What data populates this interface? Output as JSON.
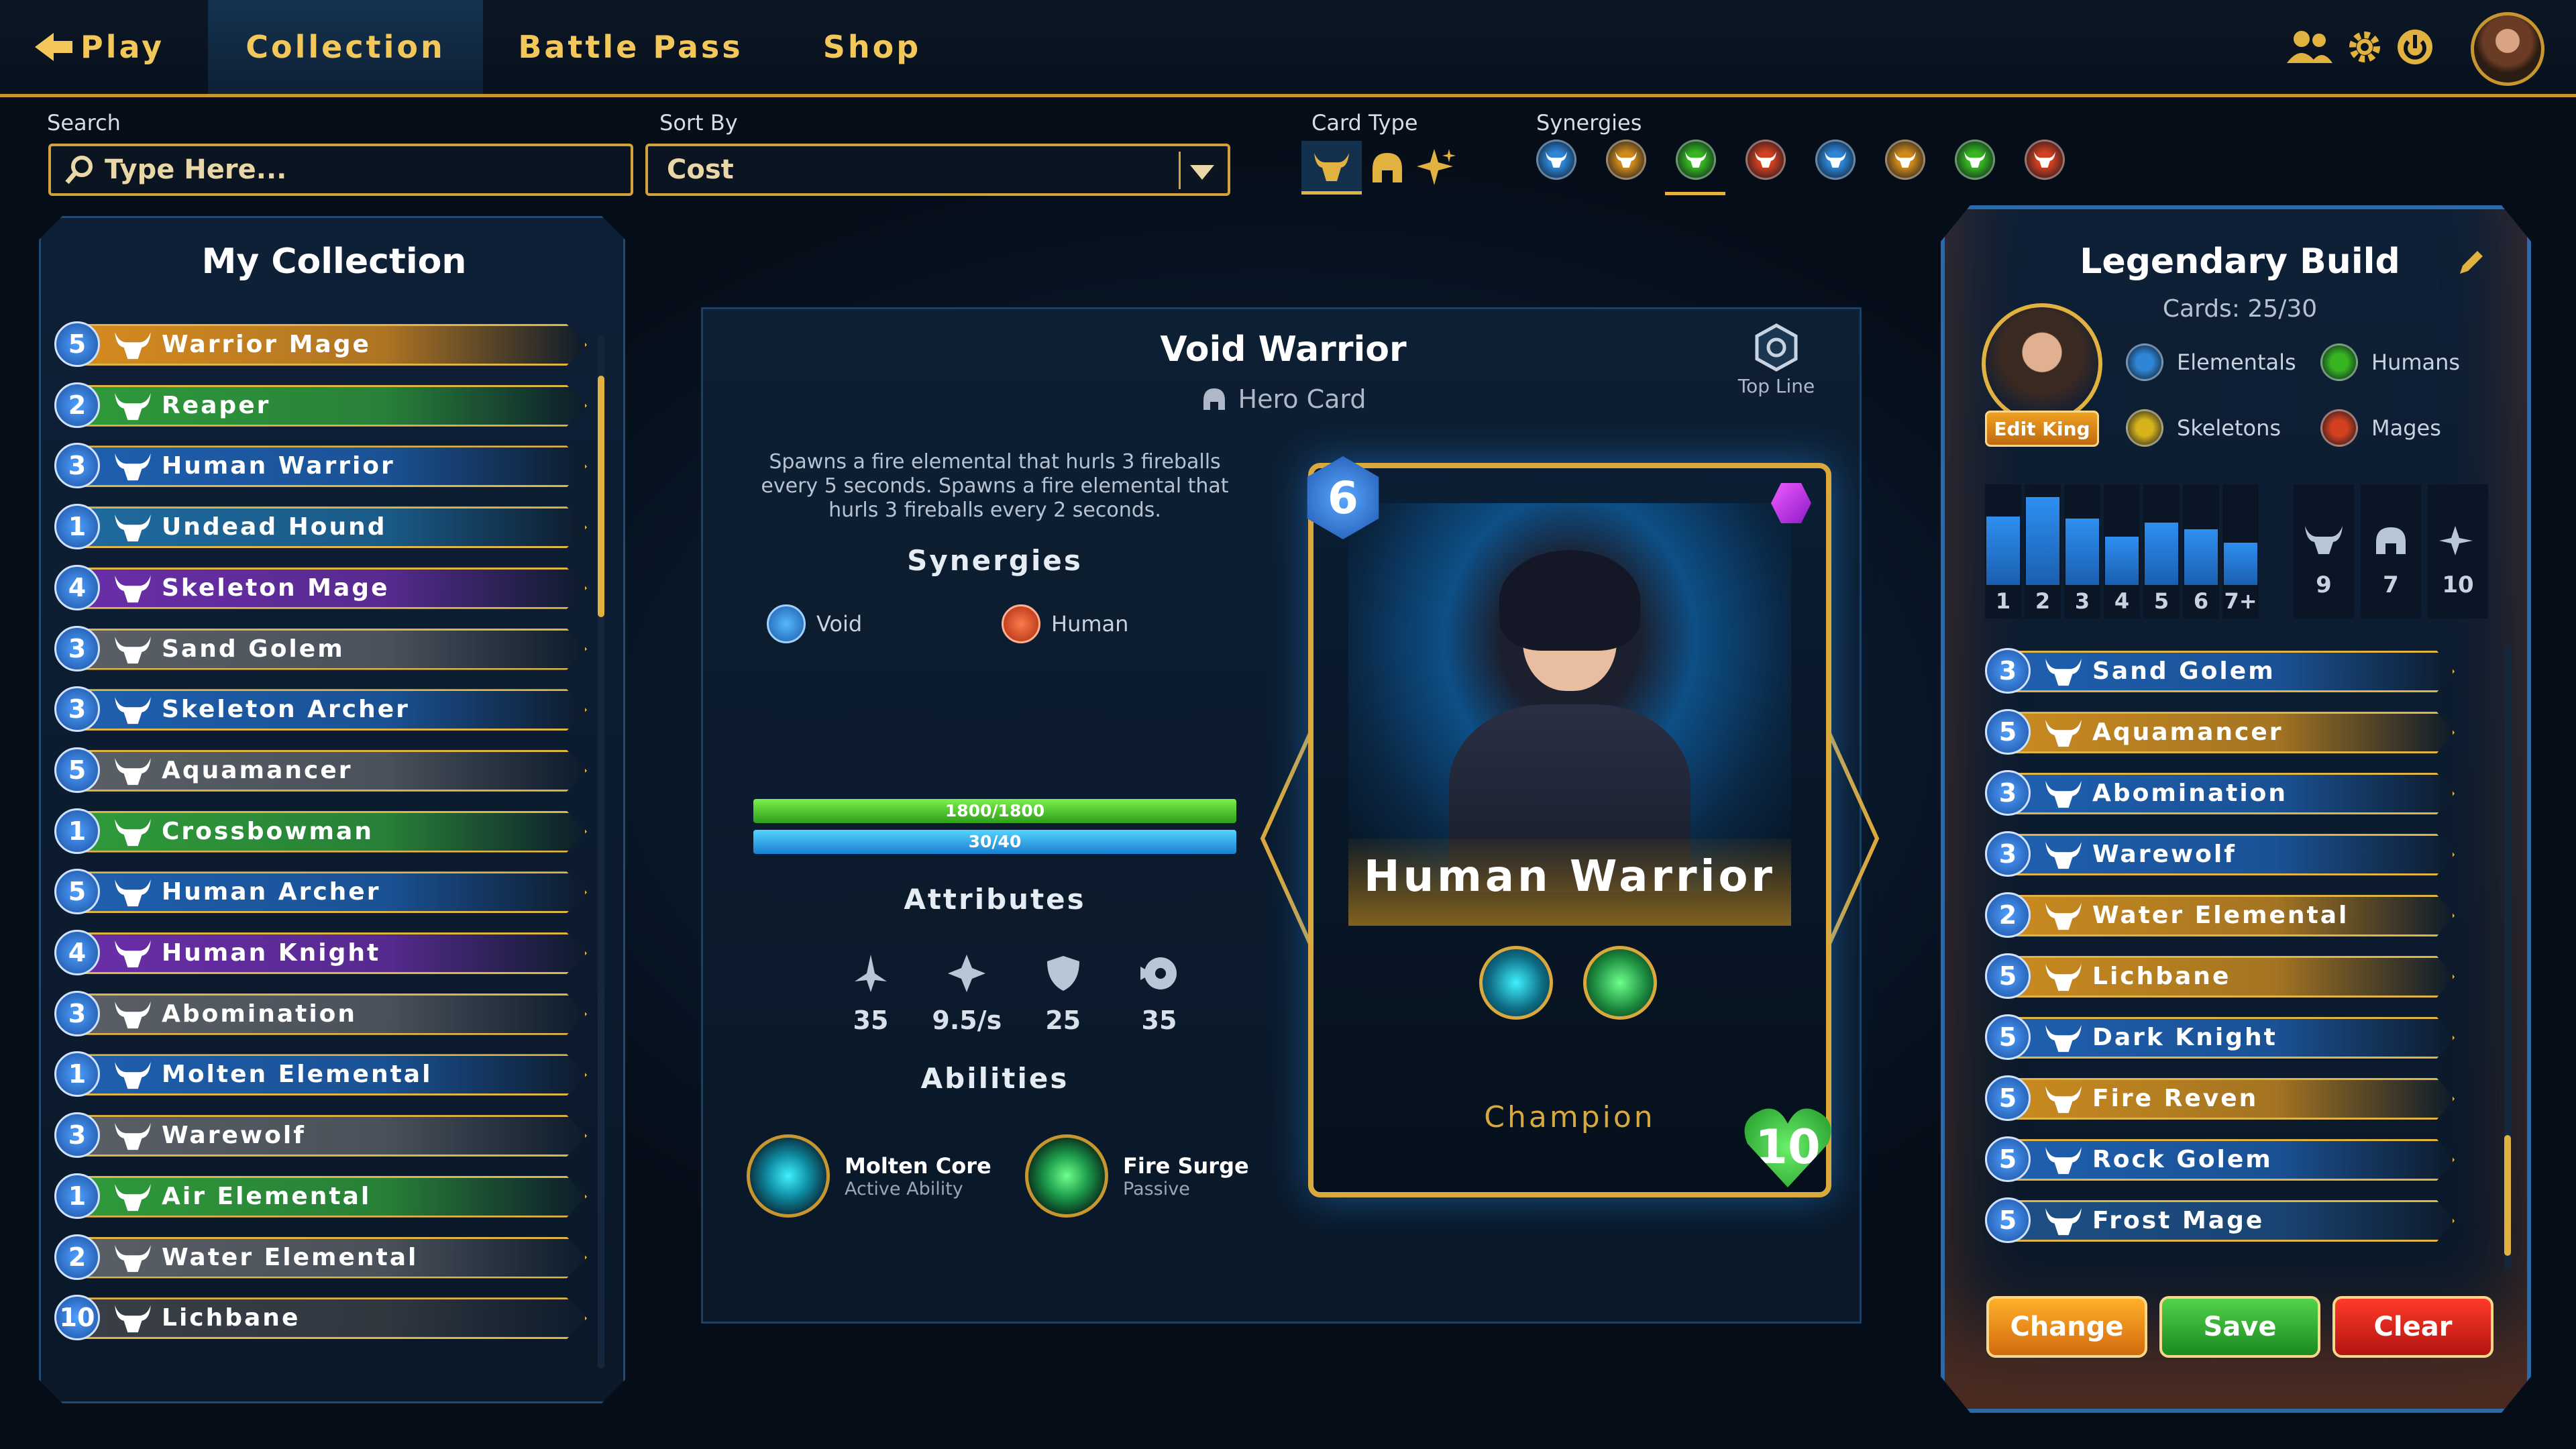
{
  "nav": {
    "back_label": "Play",
    "tabs": [
      "Collection",
      "Battle Pass",
      "Shop"
    ],
    "active_tab": "Collection"
  },
  "filters": {
    "search_label": "Search",
    "search_placeholder": "Type Here...",
    "sort_label": "Sort By",
    "sort_value": "Cost",
    "card_type_label": "Card Type",
    "synergies_label": "Synergies"
  },
  "synergy_colors": [
    "#2f86d6",
    "#d1891b",
    "#37b521",
    "#d2401f",
    "#2f86d6",
    "#d1891b",
    "#37b521",
    "#d2401f"
  ],
  "collection": {
    "title": "My Collection",
    "items": [
      {
        "cost": "5",
        "name": "Warrior Mage",
        "color": "#d68a1f"
      },
      {
        "cost": "2",
        "name": "Reaper",
        "color": "#2f9a3a"
      },
      {
        "cost": "3",
        "name": "Human Warrior",
        "color": "#1e5fae"
      },
      {
        "cost": "1",
        "name": "Undead Hound",
        "color": "#1e6a9e"
      },
      {
        "cost": "4",
        "name": "Skeleton Mage",
        "color": "#6a2ea8"
      },
      {
        "cost": "3",
        "name": "Sand Golem",
        "color": "#5a5f66"
      },
      {
        "cost": "3",
        "name": "Skeleton Archer",
        "color": "#1e5fae"
      },
      {
        "cost": "5",
        "name": "Aquamancer",
        "color": "#5a5f66"
      },
      {
        "cost": "1",
        "name": "Crossbowman",
        "color": "#2f9a3a"
      },
      {
        "cost": "5",
        "name": "Human Archer",
        "color": "#1e5fae"
      },
      {
        "cost": "4",
        "name": "Human Knight",
        "color": "#6a2ea8"
      },
      {
        "cost": "3",
        "name": "Abomination",
        "color": "#5a5f66"
      },
      {
        "cost": "1",
        "name": "Molten Elemental",
        "color": "#1e5fae"
      },
      {
        "cost": "3",
        "name": "Warewolf",
        "color": "#5a5f66"
      },
      {
        "cost": "1",
        "name": "Air Elemental",
        "color": "#2f9a3a"
      },
      {
        "cost": "2",
        "name": "Water Elemental",
        "color": "#5a5f66"
      },
      {
        "cost": "10",
        "name": "Lichbane",
        "color": "#3a3f46"
      }
    ]
  },
  "detail": {
    "name": "Void Warrior",
    "subtitle": "Hero Card",
    "top_line_label": "Top Line",
    "description": "Spawns a fire elemental that hurls 3 fireballs every 5 seconds. Spawns a fire elemental that hurls 3 fireballs every 2 seconds.",
    "synergies_title": "Synergies",
    "synergies": [
      {
        "name": "Void",
        "color": "#2f86d6"
      },
      {
        "name": "Human",
        "color": "#d2401f"
      }
    ],
    "health_text": "1800/1800",
    "health_fraction": 1.0,
    "mana_text": "30/40",
    "mana_fraction": 1.0,
    "attributes_title": "Attributes",
    "attributes": [
      {
        "icon": "sword-icon",
        "value": "35"
      },
      {
        "icon": "speed-icon",
        "value": "9.5/s"
      },
      {
        "icon": "shield-icon",
        "value": "25"
      },
      {
        "icon": "range-icon",
        "value": "35"
      }
    ],
    "abilities_title": "Abilities",
    "abilities": [
      {
        "name": "Molten Core",
        "type": "Active Ability",
        "color": "#26b5c8"
      },
      {
        "name": "Fire Surge",
        "type": "Passive",
        "color": "#2fbf5a"
      }
    ]
  },
  "card": {
    "cost": "6",
    "name": "Human Warrior",
    "class": "Champion",
    "health": "10"
  },
  "build": {
    "title": "Legendary Build",
    "cards_count": "Cards: 25/30",
    "edit_king_label": "Edit King",
    "synergies": [
      {
        "name": "Elementals",
        "color": "#2f86d6"
      },
      {
        "name": "Humans",
        "color": "#37b521"
      },
      {
        "name": "Skeletons",
        "color": "#d6b21b"
      },
      {
        "name": "Mages",
        "color": "#d2401f"
      }
    ],
    "cost_curve": {
      "labels": [
        "1",
        "2",
        "3",
        "4",
        "5",
        "6",
        "7+"
      ],
      "values": [
        0.68,
        0.87,
        0.66,
        0.48,
        0.62,
        0.55,
        0.42
      ]
    },
    "type_counts": [
      {
        "icon": "bull-icon",
        "value": "9"
      },
      {
        "icon": "helmet-icon",
        "value": "7"
      },
      {
        "icon": "sparkle-icon",
        "value": "10"
      }
    ],
    "items": [
      {
        "cost": "3",
        "name": "Sand Golem",
        "color": "#1e5fae"
      },
      {
        "cost": "5",
        "name": "Aquamancer",
        "color": "#c98a1f"
      },
      {
        "cost": "3",
        "name": "Abomination",
        "color": "#1e5fae"
      },
      {
        "cost": "3",
        "name": "Warewolf",
        "color": "#1e5fae"
      },
      {
        "cost": "2",
        "name": "Water Elemental",
        "color": "#c98a1f"
      },
      {
        "cost": "5",
        "name": "Lichbane",
        "color": "#c98a1f"
      },
      {
        "cost": "5",
        "name": "Dark Knight",
        "color": "#1e5fae"
      },
      {
        "cost": "5",
        "name": "Fire Reven",
        "color": "#c98a1f"
      },
      {
        "cost": "5",
        "name": "Rock Golem",
        "color": "#1e5fae"
      },
      {
        "cost": "5",
        "name": "Frost Mage",
        "color": "#1e4f86"
      }
    ],
    "buttons": {
      "change": "Change",
      "save": "Save",
      "clear": "Clear"
    }
  }
}
